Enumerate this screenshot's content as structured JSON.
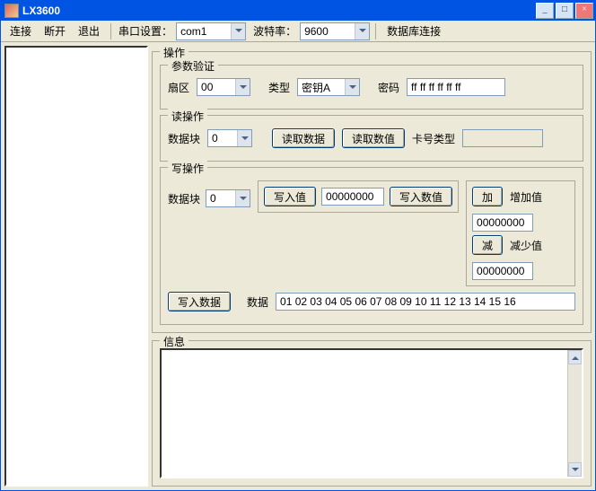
{
  "window": {
    "title": "LX3600"
  },
  "menu": {
    "connect": "连接",
    "disconnect": "断开",
    "exit": "退出",
    "serial_label": "串口设置：",
    "serial_value": "com1",
    "baud_label": "波特率：",
    "baud_value": "9600",
    "db_connect": "数据库连接"
  },
  "operation": {
    "title": "操作",
    "param": {
      "title": "参数验证",
      "sector_label": "扇区",
      "sector_value": "00",
      "type_label": "类型",
      "type_value": "密钥A",
      "password_label": "密码",
      "password_value": "ff ff ff ff ff ff"
    },
    "read": {
      "title": "读操作",
      "block_label": "数据块",
      "block_value": "0",
      "read_data_btn": "读取数据",
      "read_value_btn": "读取数值",
      "card_type_label": "卡号类型",
      "card_type_value": ""
    },
    "write": {
      "title": "写操作",
      "block_label": "数据块",
      "block_value": "0",
      "write_value_btn": "写入值",
      "write_value_input": "00000000",
      "write_num_btn": "写入数值",
      "add_btn": "加",
      "add_label": "增加值",
      "add_value": "00000000",
      "sub_btn": "减",
      "sub_label": "减少值",
      "sub_value": "00000000",
      "write_data_btn": "写入数据",
      "data_label": "数据",
      "data_value": "01 02 03 04 05 06 07 08 09 10 11 12 13 14 15 16"
    }
  },
  "info": {
    "title": "信息"
  }
}
